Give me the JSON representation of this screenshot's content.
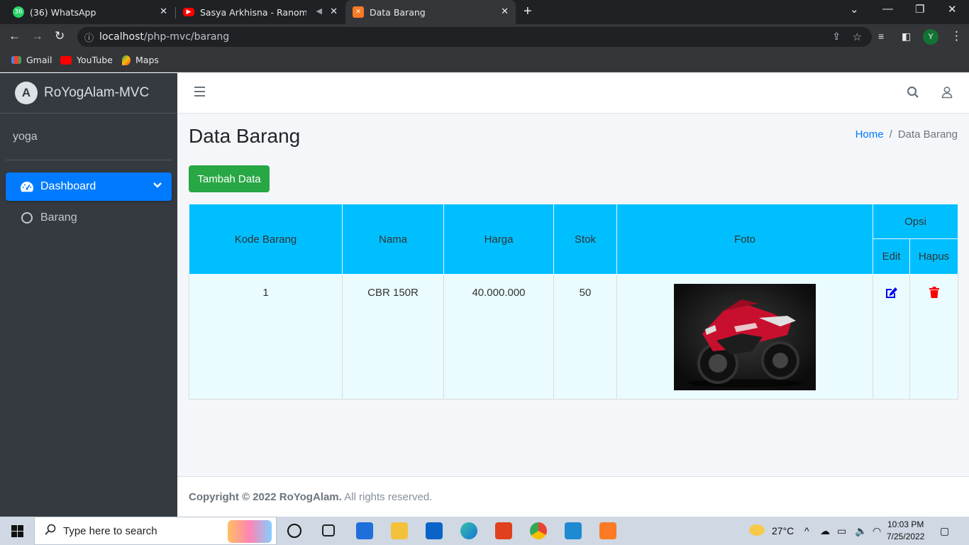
{
  "browser": {
    "tabs": [
      {
        "title": "(36) WhatsApp",
        "badge": "36"
      },
      {
        "title": "Sasya Arkhisna - Ranompo B"
      },
      {
        "title": "Data Barang"
      }
    ],
    "url_host": "localhost",
    "url_path": "/php-mvc/barang",
    "profile_initial": "Y",
    "bookmarks": [
      "Gmail",
      "YouTube",
      "Maps"
    ]
  },
  "sidebar": {
    "brand": "RoYogAlam-MVC",
    "brand_logo_letter": "A",
    "user": "yoga",
    "items": [
      {
        "label": "Dashboard",
        "icon": "tachometer-icon"
      },
      {
        "label": "Barang",
        "icon": "circle-icon"
      }
    ]
  },
  "page": {
    "title": "Data Barang",
    "breadcrumb": {
      "home": "Home",
      "current": "Data Barang",
      "separator": "/"
    },
    "add_button": "Tambah Data"
  },
  "table": {
    "headers": {
      "kode": "Kode Barang",
      "nama": "Nama",
      "harga": "Harga",
      "stok": "Stok",
      "foto": "Foto",
      "opsi": "Opsi",
      "edit": "Edit",
      "hapus": "Hapus"
    },
    "rows": [
      {
        "kode": "1",
        "nama": "CBR 150R",
        "harga": "40.000.000",
        "stok": "50"
      }
    ]
  },
  "footer": {
    "copyright": "Copyright © 2022 RoYogAlam.",
    "rights": " All rights reserved."
  },
  "taskbar": {
    "search_placeholder": "Type here to search",
    "weather": "27°C",
    "time": "10:03 PM",
    "date": "7/25/2022"
  },
  "colors": {
    "sidebar_bg": "#343a40",
    "primary": "#007bff",
    "success": "#28a745",
    "table_header": "#00bfff",
    "table_row": "#eafcff",
    "danger": "#ff0000"
  }
}
